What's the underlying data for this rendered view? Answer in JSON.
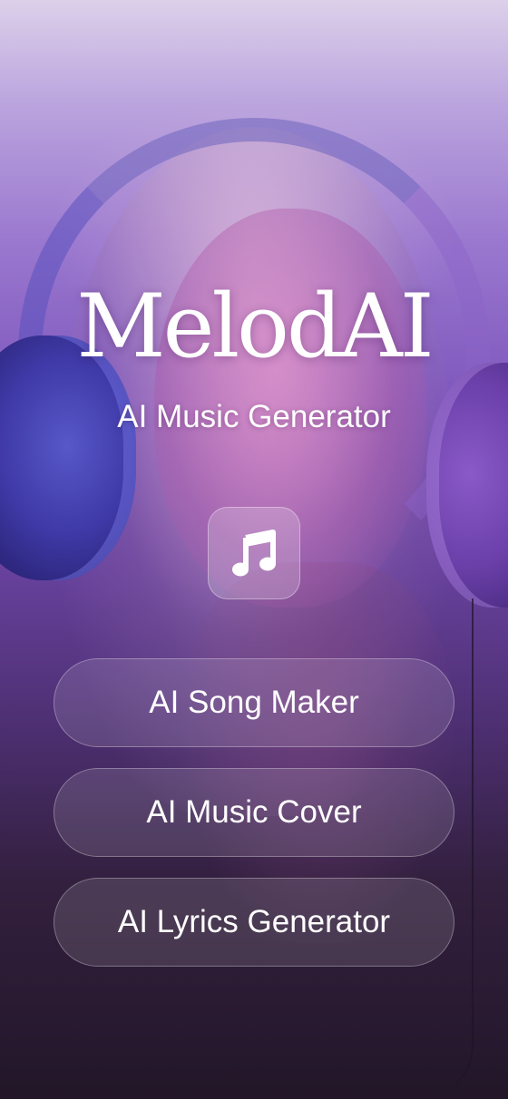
{
  "app": {
    "name": "MelodAI",
    "subtitle": "AI Music Generator",
    "icon": "music-note-icon"
  },
  "menu": {
    "items": [
      {
        "label": "AI Song Maker"
      },
      {
        "label": "AI Music Cover"
      },
      {
        "label": "AI Lyrics Generator"
      }
    ]
  },
  "colors": {
    "background_top": "#dcd0ea",
    "background_mid": "#7f58bd",
    "background_bottom": "#221628",
    "text": "#ffffff"
  }
}
